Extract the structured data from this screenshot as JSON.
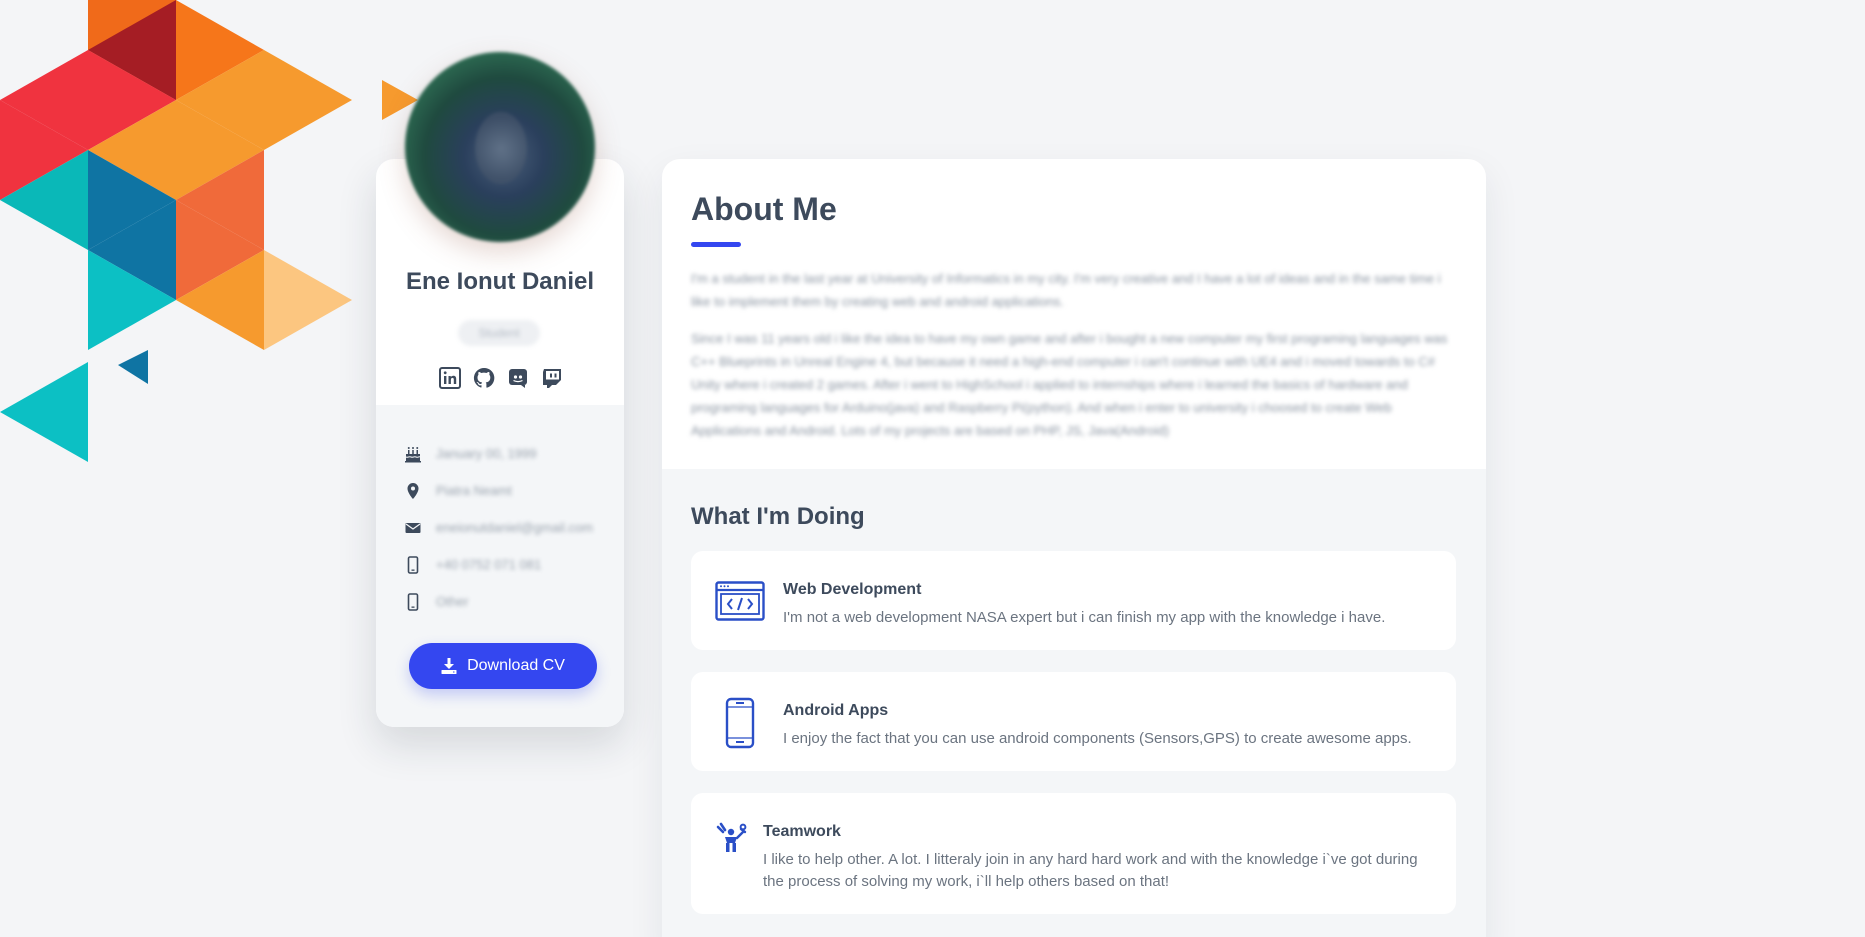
{
  "profile": {
    "name": "Ene Ionut Daniel",
    "role": "Student",
    "socials": [
      {
        "name": "LinkedIn",
        "icon": "linkedin-icon"
      },
      {
        "name": "GitHub",
        "icon": "github-icon"
      },
      {
        "name": "Discord",
        "icon": "discord-icon"
      },
      {
        "name": "Twitch",
        "icon": "twitch-icon"
      }
    ],
    "info": [
      {
        "icon": "birthday-cake-icon",
        "value": "January 00, 1999"
      },
      {
        "icon": "location-pin-icon",
        "value": "Piatra Neamt"
      },
      {
        "icon": "email-icon",
        "value": "eneionutdaniel@gmail.com"
      },
      {
        "icon": "phone-icon",
        "value": "+40 0752 071 081"
      },
      {
        "icon": "phone-icon",
        "value": "Other"
      }
    ],
    "download_label": "Download CV"
  },
  "about": {
    "title": "About Me",
    "paragraphs": [
      "I'm a student in the last year at University of Informatics in my city. I'm very creative and I have a lot of ideas and in the same time i like to implement them by creating web and android applications.",
      "Since I was 11 years old i like the idea to have my own game and after i bought a new computer my first programing languages was C++ Blueprints in Unreal Engine 4, but because it need a high-end computer i can't continue with UE4 and i moved towards to C# Unity where i created 2 games. After i went to HighSchool i applied to internships where i learned the basics of hardware and programing languages for Arduino(java) and Raspberry Pi(python). And when i enter to university i choosed to create Web Applications and Android. Lots of my projects are based on PHP, JS, Java(Android)"
    ]
  },
  "doing": {
    "title": "What I'm Doing",
    "services": [
      {
        "icon": "web-development-icon",
        "title": "Web Development",
        "desc": "I'm not a web development NASA expert but i can finish my app with the knowledge i have."
      },
      {
        "icon": "smartphone-icon",
        "title": "Android Apps",
        "desc": "I enjoy the fact that you can use android components (Sensors,GPS) to create awesome apps."
      },
      {
        "icon": "teamwork-icon",
        "title": "Teamwork",
        "desc": "I like to help other. A lot. I litteraly join in any hard hard work and with the knowledge i`ve got during the process of solving my work, i`ll help others based on that!"
      }
    ]
  },
  "colors": {
    "accent": "#3447f0",
    "background": "#f4f5f7",
    "text": "#3d4a5c"
  }
}
